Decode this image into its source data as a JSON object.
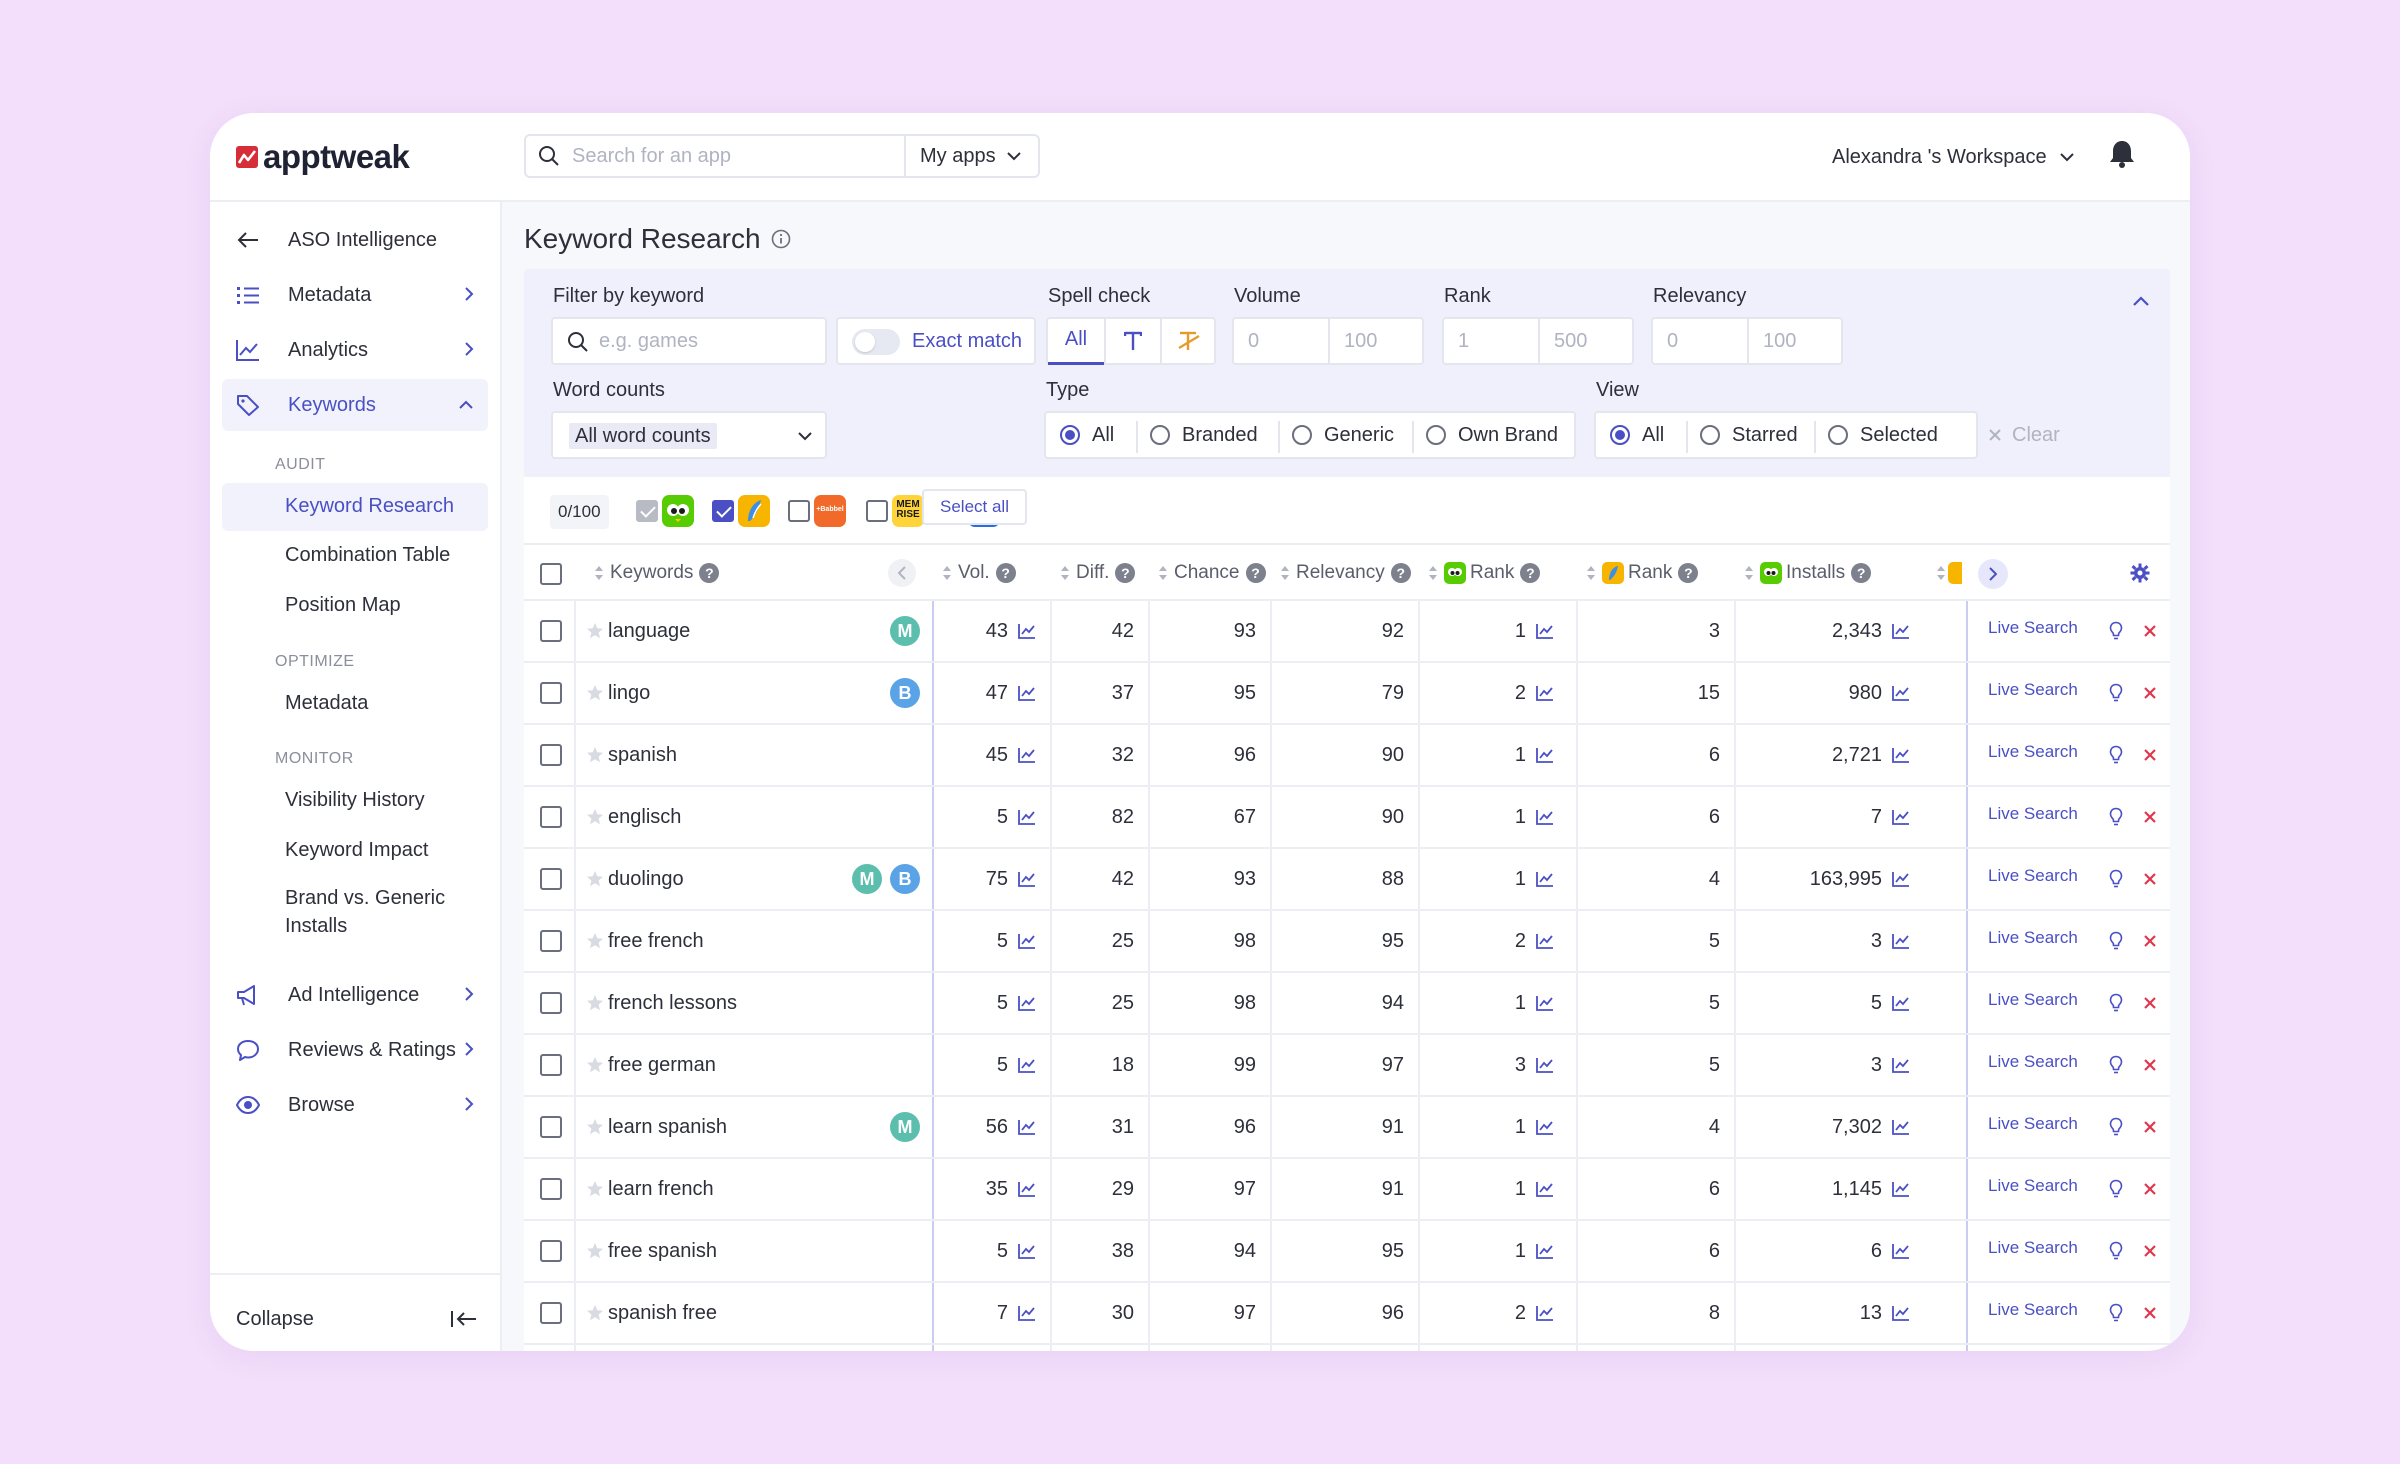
{
  "brand": {
    "name": "apptweak",
    "logo_color": "#d62d38",
    "accent": "#4a50c4"
  },
  "header": {
    "search_placeholder": "Search for an app",
    "my_apps": "My apps",
    "workspace": "Alexandra 's Workspace"
  },
  "sidebar": {
    "back": "ASO Intelligence",
    "items": [
      {
        "label": "Metadata",
        "icon": "list-icon"
      },
      {
        "label": "Analytics",
        "icon": "chart-icon"
      },
      {
        "label": "Keywords",
        "icon": "tag-icon",
        "active": true
      }
    ],
    "sections": [
      {
        "label": "AUDIT",
        "items": [
          "Keyword Research",
          "Combination Table",
          "Position Map"
        ]
      },
      {
        "label": "OPTIMIZE",
        "items": [
          "Metadata"
        ]
      },
      {
        "label": "MONITOR",
        "items": [
          "Visibility History",
          "Keyword Impact",
          "Brand vs. Generic Installs"
        ]
      }
    ],
    "bottom_items": [
      {
        "label": "Ad Intelligence",
        "icon": "megaphone-icon"
      },
      {
        "label": "Reviews & Ratings",
        "icon": "chat-icon"
      },
      {
        "label": "Browse",
        "icon": "eye-icon"
      }
    ],
    "collapse": "Collapse"
  },
  "page": {
    "title": "Keyword Research"
  },
  "filters": {
    "filter_by_keyword": "Filter by keyword",
    "keyword_placeholder": "e.g. games",
    "exact_match": "Exact match",
    "spell_check": "Spell check",
    "spell_all": "All",
    "volume": {
      "label": "Volume",
      "min_ph": "0",
      "max_ph": "100"
    },
    "rank": {
      "label": "Rank",
      "min_ph": "1",
      "max_ph": "500"
    },
    "relevancy": {
      "label": "Relevancy",
      "min_ph": "0",
      "max_ph": "100"
    },
    "word_counts": {
      "label": "Word counts",
      "value": "All word counts"
    },
    "type": {
      "label": "Type",
      "options": [
        "All",
        "Branded",
        "Generic",
        "Own Brand"
      ],
      "selected": "All"
    },
    "view": {
      "label": "View",
      "options": [
        "All",
        "Starred",
        "Selected"
      ],
      "selected": "All"
    },
    "clear": "Clear"
  },
  "app_selector": {
    "counter": "0/100",
    "select_all": "Select all",
    "memrise_text": "MEM RISE",
    "babbel_text": "+Babbel"
  },
  "table": {
    "columns": {
      "keywords": "Keywords",
      "vol": "Vol.",
      "diff": "Diff.",
      "chance": "Chance",
      "relevancy": "Relevancy",
      "rank1": "Rank",
      "rank2": "Rank",
      "installs": "Installs"
    },
    "live_search": "Live Search",
    "rows": [
      {
        "keyword": "language",
        "badges": [
          "M"
        ],
        "vol": "43",
        "diff": "42",
        "chance": "93",
        "relevancy": "92",
        "rank1": "1",
        "rank2": "3",
        "installs": "2,343"
      },
      {
        "keyword": "lingo",
        "badges": [
          "B"
        ],
        "vol": "47",
        "diff": "37",
        "chance": "95",
        "relevancy": "79",
        "rank1": "2",
        "rank2": "15",
        "installs": "980"
      },
      {
        "keyword": "spanish",
        "badges": [],
        "vol": "45",
        "diff": "32",
        "chance": "96",
        "relevancy": "90",
        "rank1": "1",
        "rank2": "6",
        "installs": "2,721"
      },
      {
        "keyword": "englisch",
        "badges": [],
        "vol": "5",
        "diff": "82",
        "chance": "67",
        "relevancy": "90",
        "rank1": "1",
        "rank2": "6",
        "installs": "7"
      },
      {
        "keyword": "duolingo",
        "badges": [
          "M",
          "B"
        ],
        "vol": "75",
        "diff": "42",
        "chance": "93",
        "relevancy": "88",
        "rank1": "1",
        "rank2": "4",
        "installs": "163,995"
      },
      {
        "keyword": "free french",
        "badges": [],
        "vol": "5",
        "diff": "25",
        "chance": "98",
        "relevancy": "95",
        "rank1": "2",
        "rank2": "5",
        "installs": "3"
      },
      {
        "keyword": "french lessons",
        "badges": [],
        "vol": "5",
        "diff": "25",
        "chance": "98",
        "relevancy": "94",
        "rank1": "1",
        "rank2": "5",
        "installs": "5"
      },
      {
        "keyword": "free german",
        "badges": [],
        "vol": "5",
        "diff": "18",
        "chance": "99",
        "relevancy": "97",
        "rank1": "3",
        "rank2": "5",
        "installs": "3"
      },
      {
        "keyword": "learn spanish",
        "badges": [
          "M"
        ],
        "vol": "56",
        "diff": "31",
        "chance": "96",
        "relevancy": "91",
        "rank1": "1",
        "rank2": "4",
        "installs": "7,302"
      },
      {
        "keyword": "learn french",
        "badges": [],
        "vol": "35",
        "diff": "29",
        "chance": "97",
        "relevancy": "91",
        "rank1": "1",
        "rank2": "6",
        "installs": "1,145"
      },
      {
        "keyword": "free spanish",
        "badges": [],
        "vol": "5",
        "diff": "38",
        "chance": "94",
        "relevancy": "95",
        "rank1": "1",
        "rank2": "6",
        "installs": "6"
      },
      {
        "keyword": "spanish free",
        "badges": [],
        "vol": "7",
        "diff": "30",
        "chance": "97",
        "relevancy": "96",
        "rank1": "2",
        "rank2": "8",
        "installs": "13"
      }
    ]
  }
}
